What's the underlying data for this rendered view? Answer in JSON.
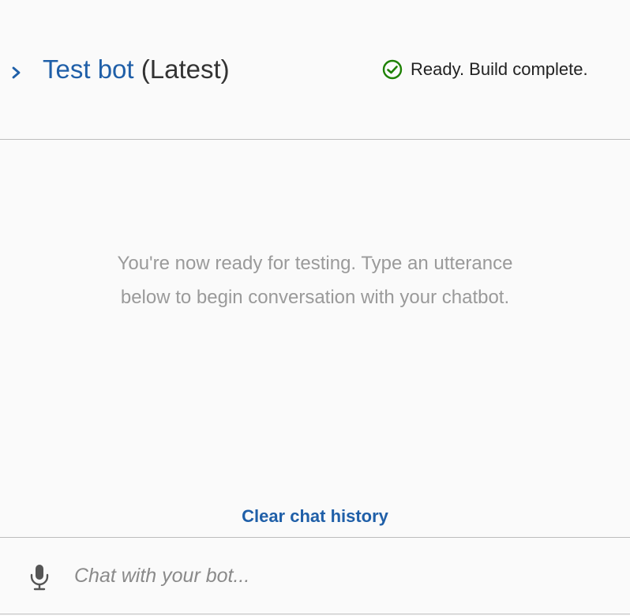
{
  "header": {
    "title_link": "Test bot",
    "title_suffix": "(Latest)",
    "status_text": "Ready. Build complete."
  },
  "icons": {
    "expand": "chevron-right-icon",
    "status": "check-circle-icon",
    "microphone": "microphone-icon"
  },
  "colors": {
    "link": "#1f5fa8",
    "success": "#1d8102",
    "muted_text": "#9a9a9a",
    "divider": "#bdbdbd",
    "background": "#fafafa"
  },
  "conversation": {
    "empty_line_1": "You're now ready for testing. Type an utterance",
    "empty_line_2": "below to begin conversation with your chatbot."
  },
  "actions": {
    "clear_history": "Clear chat history"
  },
  "input": {
    "value": "",
    "placeholder": "Chat with your bot..."
  }
}
